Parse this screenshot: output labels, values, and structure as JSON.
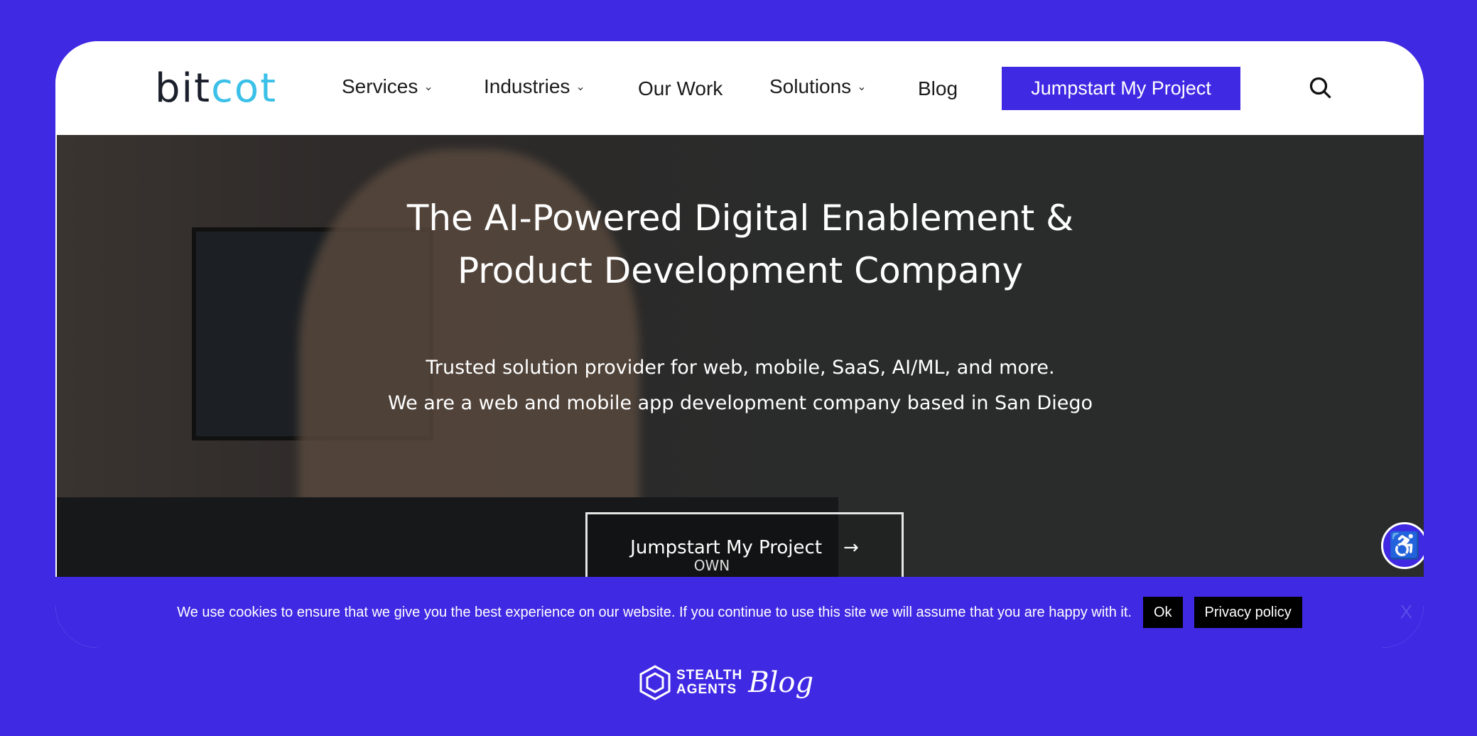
{
  "header": {
    "logo": {
      "part1": "bit",
      "part2": "cot"
    },
    "nav": [
      {
        "label": "Services",
        "dropdown": true
      },
      {
        "label": "Industries",
        "dropdown": true
      },
      {
        "label": "Our Work",
        "dropdown": false
      },
      {
        "label": "Solutions",
        "dropdown": true
      },
      {
        "label": "Blog",
        "dropdown": false
      }
    ],
    "cta": "Jumpstart My Project",
    "search_icon": "search-icon"
  },
  "hero": {
    "title_line1": "The AI-Powered Digital Enablement &",
    "title_line2": "Product Development Company",
    "subtitle_line1": "Trusted solution provider for web, mobile, SaaS, AI/ML, and more.",
    "subtitle_line2": "We are a web and mobile app development company based in San Diego",
    "cta": "Jumpstart My Project",
    "cta_arrow": "→",
    "scroll_hint": "OWN"
  },
  "cookie": {
    "text": "We use cookies to ensure that we give you the best experience on our website. If you continue to use this site we will assume that you are happy with it.",
    "ok": "Ok",
    "privacy": "Privacy policy",
    "close": "X"
  },
  "footer": {
    "brand_line1": "STEALTH",
    "brand_line2": "AGENTS",
    "script": "Blog"
  },
  "colors": {
    "brand": "#4029e3",
    "logo_accent": "#3bc0e8"
  }
}
